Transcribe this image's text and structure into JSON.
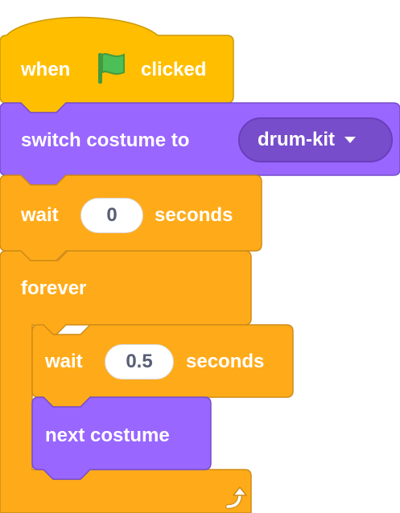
{
  "colors": {
    "events": "#FFBF00",
    "looks": "#9966FF",
    "control": "#FFAB19",
    "flag_green": "#4CBF56"
  },
  "blocks": {
    "hat": {
      "when": "when",
      "flag_icon": "green-flag-icon",
      "clicked": "clicked"
    },
    "switch_costume": {
      "label": "switch costume to",
      "value": "drum-kit"
    },
    "wait_outer": {
      "label": "wait",
      "value": "0",
      "unit": "seconds"
    },
    "forever": {
      "label": "forever",
      "loop_icon": "loop-arrow-icon"
    },
    "wait_inner": {
      "label": "wait",
      "value": "0.5",
      "unit": "seconds"
    },
    "next_costume": {
      "label": "next costume"
    }
  }
}
